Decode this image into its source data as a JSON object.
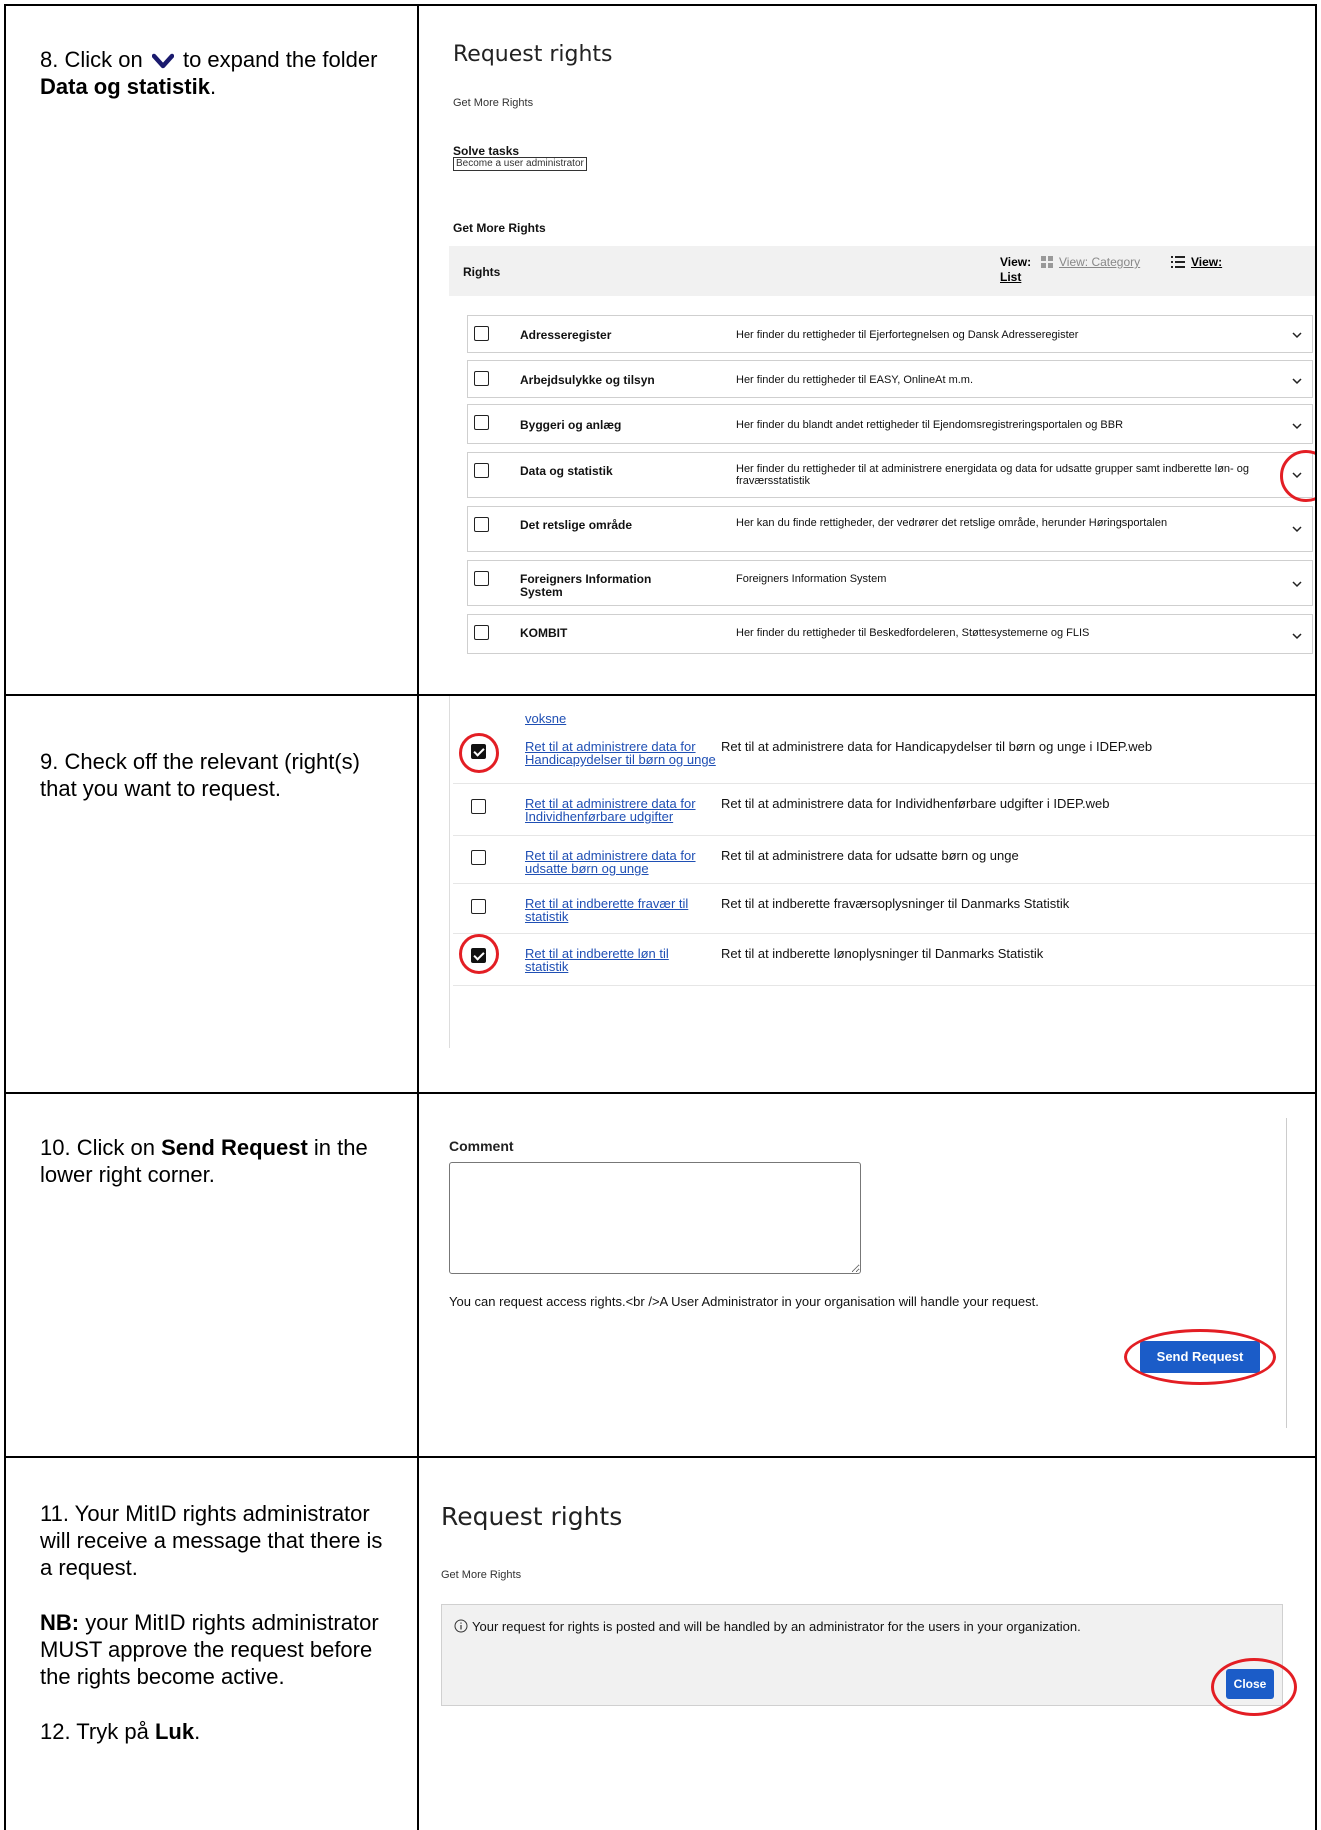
{
  "step8": {
    "instruction_a": "8. Click on",
    "instruction_b": "to expand the folder",
    "folder_name": "Data og statistik",
    "period": ".",
    "screenshot": {
      "title": "Request rights",
      "breadcrumb": "Get More Rights",
      "solve_tasks_heading": "Solve tasks",
      "solve_tasks_link": "Become a user administrator",
      "section_heading": "Get More Rights",
      "rights_label": "Rights",
      "view_label": "View:",
      "view_category": "View: Category",
      "view_list_a": "View:",
      "view_list_b": "List",
      "rows": [
        {
          "name": "Adresseregister",
          "desc": "Her finder du rettigheder til Ejerfortegnelsen og Dansk Adresseregister"
        },
        {
          "name": "Arbejdsulykke og tilsyn",
          "desc": "Her finder du rettigheder til EASY, OnlineAt m.m."
        },
        {
          "name": "Byggeri og anlæg",
          "desc": "Her finder du blandt andet rettigheder til Ejendomsregistreringsportalen og BBR"
        },
        {
          "name": "Data og statistik",
          "desc": "Her finder du rettigheder til at administrere energidata og data for udsatte grupper samt indberette løn- og fraværsstatistik"
        },
        {
          "name": "Det retslige område",
          "desc": "Her kan du finde rettigheder, der vedrører det retslige område, herunder Høringsportalen"
        },
        {
          "name": "Foreigners Information System",
          "desc": "Foreigners Information System"
        },
        {
          "name": "KOMBIT",
          "desc": "Her finder du rettigheder til Beskedfordeleren, Støttesystemerne og FLIS"
        }
      ]
    }
  },
  "step9": {
    "instruction": "9. Check off the relevant (right(s) that you want to request.",
    "screenshot": {
      "partial_link": "voksne",
      "rows": [
        {
          "link": "Ret til at administrere data for Handicapydelser til børn og unge",
          "desc": "Ret til at administrere data for Handicapydelser til børn og unge i IDEP.web",
          "checked": true
        },
        {
          "link": "Ret til at administrere data for Individhenførbare udgifter",
          "desc": "Ret til at administrere data for Individhenførbare udgifter i IDEP.web",
          "checked": false
        },
        {
          "link": "Ret til at administrere data for udsatte børn og unge",
          "desc": "Ret til at administrere data for udsatte børn og unge",
          "checked": false
        },
        {
          "link": "Ret til at indberette fravær til statistik",
          "desc": "Ret til at indberette fraværsoplysninger til Danmarks Statistik",
          "checked": false
        },
        {
          "link": "Ret til at indberette løn til statistik",
          "desc": "Ret til at indberette lønoplysninger til Danmarks Statistik",
          "checked": true
        }
      ]
    }
  },
  "step10": {
    "instruction_a": "10. Click on",
    "instruction_bold": "Send Request",
    "instruction_b": "in the lower right corner.",
    "screenshot": {
      "comment_label": "Comment",
      "comment_value": "",
      "notice": "You can request access rights.<br />A User Administrator in your organisation will handle your request.",
      "send_button": "Send Request"
    }
  },
  "step11": {
    "instruction": "11. Your MitID rights administrator will receive a message that there is a request.",
    "nb_label": "NB:",
    "nb_text": "your MitID rights administrator MUST approve the request before the rights become active.",
    "step12_a": "12. Tryk på",
    "step12_bold": "Luk",
    "step12_b": ".",
    "screenshot": {
      "title": "Request rights",
      "breadcrumb": "Get More Rights",
      "info_text": "Your request for rights is posted and will be handled by an administrator for the users in your organization.",
      "close_button": "Close"
    }
  },
  "colors": {
    "accent": "#1b5cc8",
    "highlight": "#e31e24",
    "link": "#1f4fb4",
    "header_bg": "#f1f1f1"
  }
}
